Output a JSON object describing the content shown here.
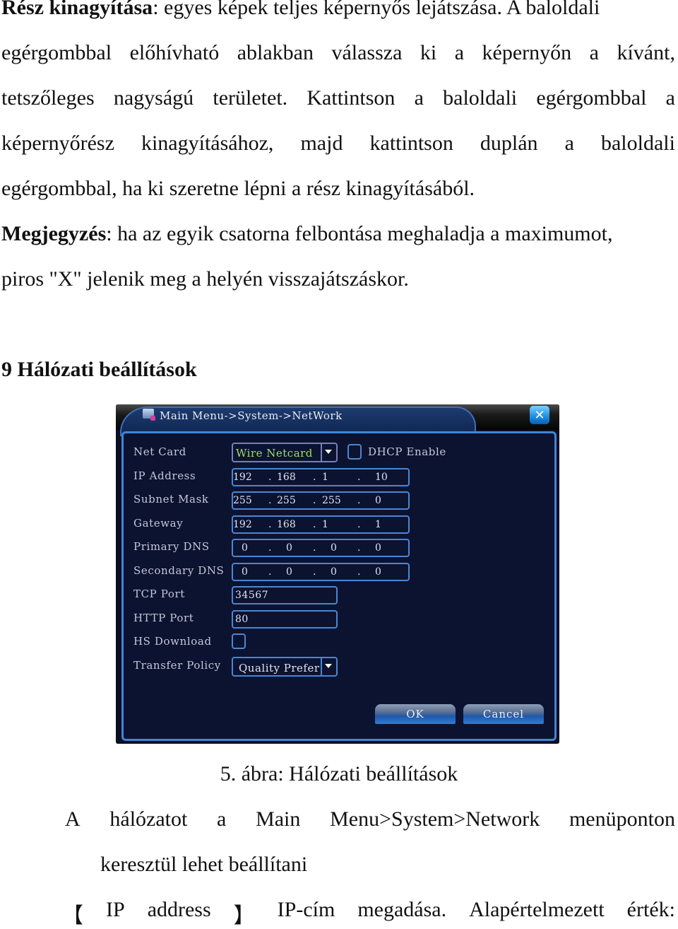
{
  "paragraph1": {
    "bold_lead": "Rész kinagyítása",
    "lines": [
      ": egyes képek teljes képernyős lejátszása. A baloldali",
      "egérgombbal előhívható ablakban válassza ki a képernyőn a kívánt,",
      "tetszőleges nagyságú területet. Kattintson a baloldali egérgombbal a",
      "képernyőrész kinagyításához, majd kattintson duplán a baloldali",
      "egérgombbal, ha ki szeretne lépni a rész kinagyításából."
    ]
  },
  "note": {
    "bold_lead": "Megjegyzés",
    "line1": ": ha az egyik csatorna felbontása meghaladja a maximumot,",
    "line2": "piros \"X\" jelenik meg a helyén visszajátszáskor."
  },
  "section_heading": "9 Hálózati beállítások",
  "dialog": {
    "title": "Main Menu->System->NetWork",
    "close_label": "✕",
    "fields": {
      "net_card": {
        "label": "Net Card",
        "value": "Wire Netcard"
      },
      "dhcp": {
        "label": "DHCP Enable",
        "checked": false
      },
      "ip_address": {
        "label": "IP Address",
        "octets": [
          "192",
          "168",
          "1",
          "10"
        ]
      },
      "subnet_mask": {
        "label": "Subnet Mask",
        "octets": [
          "255",
          "255",
          "255",
          "0"
        ]
      },
      "gateway": {
        "label": "Gateway",
        "octets": [
          "192",
          "168",
          "1",
          "1"
        ]
      },
      "primary_dns": {
        "label": "Primary DNS",
        "octets": [
          "0",
          "0",
          "0",
          "0"
        ]
      },
      "secondary_dns": {
        "label": "Secondary DNS",
        "octets": [
          "0",
          "0",
          "0",
          "0"
        ]
      },
      "tcp_port": {
        "label": "TCP Port",
        "value": "34567"
      },
      "http_port": {
        "label": "HTTP Port",
        "value": "80"
      },
      "hs_download": {
        "label": "HS Download",
        "checked": false
      },
      "transfer_policy": {
        "label": "Transfer Policy",
        "value": "Quality Prefer"
      }
    },
    "ok_label": "OK",
    "cancel_label": "Cancel",
    "colors": {
      "panel_bg": "#0c1330",
      "border": "#4b86d2",
      "netcard_text": "#9de05a",
      "label_text": "#c3c8d8"
    }
  },
  "figure_caption": "5. ábra: Hálózati beállítások",
  "body": {
    "line1_words": [
      "A",
      "hálózatot",
      "a",
      "Main",
      "Menu>System>Network",
      "menüponton"
    ],
    "line2": "keresztül lehet beállítani",
    "line3_words": [
      "【",
      "IP",
      "address",
      "】",
      "IP-cím",
      "megadása.",
      "Alapértelmezett",
      "érték:"
    ]
  }
}
